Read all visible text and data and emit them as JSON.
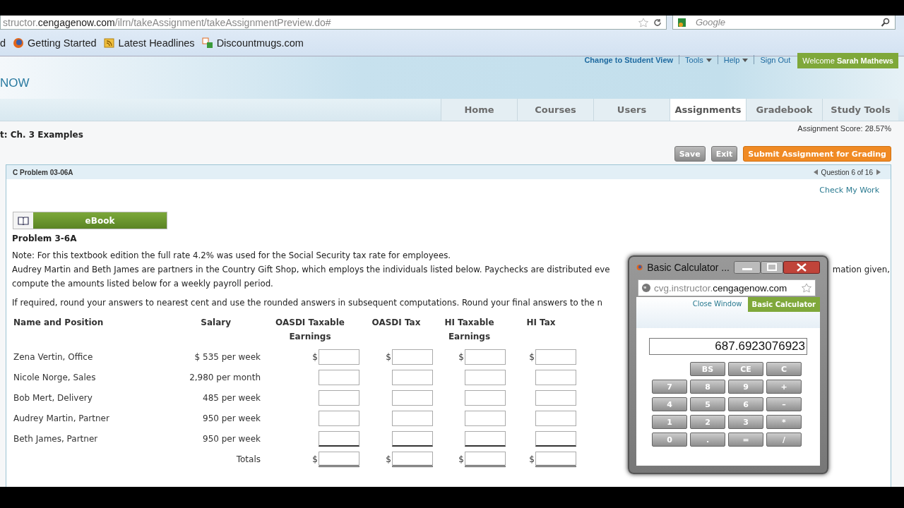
{
  "browser": {
    "url": {
      "prefix": "structor.",
      "domain": "cengagenow.com",
      "path": "/ilrn/takeAssignment/takeAssignmentPreview.do#"
    },
    "search": {
      "placeholder": "Google"
    }
  },
  "bookmarks": [
    {
      "label": "d",
      "kind": "none"
    },
    {
      "label": "Getting Started",
      "kind": "firefox"
    },
    {
      "label": "Latest Headlines",
      "kind": "rss"
    },
    {
      "label": "Discountmugs.com",
      "kind": "dm"
    }
  ],
  "header": {
    "logo": "NOW",
    "links": [
      {
        "label": "Change to Student View",
        "menu": false,
        "bold": true
      },
      {
        "label": "Tools",
        "menu": true,
        "bold": false
      },
      {
        "label": "Help",
        "menu": true,
        "bold": false
      },
      {
        "label": "Sign Out",
        "menu": false,
        "bold": false
      }
    ],
    "welcome": "Welcome **Sarah Mathews**"
  },
  "tabs": [
    {
      "label": "Home",
      "selected": false
    },
    {
      "label": "Courses",
      "selected": false
    },
    {
      "label": "Users",
      "selected": false
    },
    {
      "label": "Assignments",
      "selected": true
    },
    {
      "label": "Gradebook",
      "selected": false
    },
    {
      "label": "Study Tools",
      "selected": false
    }
  ],
  "assignment": {
    "title": "t: Ch. 3 Examples",
    "score": "Assignment Score: 28.57%",
    "buttons": [
      {
        "label": "Save",
        "kind": "gray"
      },
      {
        "label": "Exit",
        "kind": "gray"
      },
      {
        "label": "Submit Assignment for Grading",
        "kind": "orange"
      }
    ]
  },
  "question": {
    "title": "C Problem 03-06A",
    "position": "Question 6 of 16",
    "check": "Check My Work",
    "ebook": "eBook",
    "problem": "Problem 3-6A",
    "note": "Note: For this textbook edition the full rate 4.2% was used for the Social Security tax rate for employees.",
    "intro_left": "Audrey Martin and Beth James are partners in the Country Gift Shop, which employs the individuals listed below. Paychecks are distributed eve",
    "intro_right": "mation given,",
    "intro_end": "compute the amounts listed below for a weekly payroll period.",
    "rounding": "If required, round your answers to nearest cent and use the rounded answers in subsequent computations. Round your final answers to the n",
    "columns": [
      {
        "label": "Name and Position"
      },
      {
        "label": "Salary"
      },
      {
        "label": "OASDI Taxable Earnings"
      },
      {
        "label": "OASDI Tax"
      },
      {
        "label": "HI Taxable Earnings"
      },
      {
        "label": "HI Tax"
      }
    ],
    "rows": [
      {
        "kind": "person",
        "name": "Zena Vertin, Office",
        "salary": "$ 535 per week",
        "prefix": "$",
        "underlined": false
      },
      {
        "kind": "person",
        "name": "Nicole Norge, Sales",
        "salary": "2,980 per month",
        "underlined": false
      },
      {
        "kind": "person",
        "name": "Bob Mert, Delivery",
        "salary": "485 per week",
        "underlined": false
      },
      {
        "kind": "person",
        "name": "Audrey Martin, Partner",
        "salary": "950 per week",
        "underlined": false
      },
      {
        "kind": "person",
        "name": "Beth James, Partner",
        "salary": "950 per week",
        "underlined": true
      },
      {
        "kind": "total",
        "label": "Totals",
        "prefix": "$",
        "underlined": true
      }
    ]
  },
  "calculator": {
    "title": "Basic Calculator ...",
    "address": {
      "prefix": "cvg.instructor.",
      "domain": "cengagenow.com"
    },
    "close": "Close Window",
    "tab": "Basic Calculator",
    "display": "687.6923076923",
    "keys": [
      "BS",
      "CE",
      "C",
      "7",
      "8",
      "9",
      "+",
      "4",
      "5",
      "6",
      "–",
      "1",
      "2",
      "3",
      "*",
      "0",
      ".",
      "=",
      "/"
    ]
  }
}
